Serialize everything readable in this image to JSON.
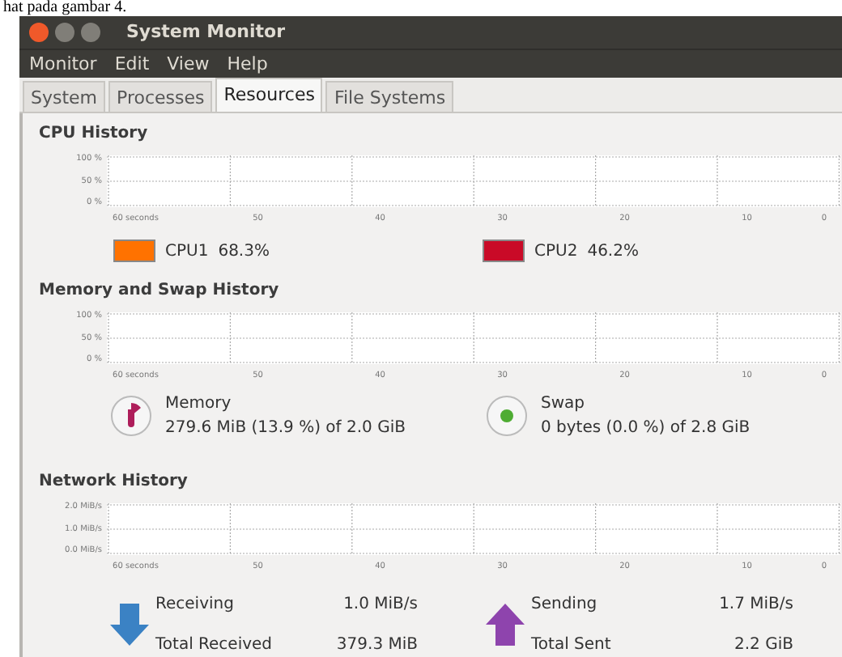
{
  "document_line": "hat pada gambar 4.",
  "window": {
    "title": "System Monitor"
  },
  "menu": [
    "Monitor",
    "Edit",
    "View",
    "Help"
  ],
  "tabs": [
    {
      "label": "System",
      "selected": false
    },
    {
      "label": "Processes",
      "selected": false
    },
    {
      "label": "Resources",
      "selected": true
    },
    {
      "label": "File Systems",
      "selected": false
    }
  ],
  "cpu": {
    "title": "CPU History",
    "graph": {
      "y_labels": [
        "100 %",
        "50 %",
        "0 %"
      ],
      "x_labels": [
        "60 seconds",
        "50",
        "40",
        "30",
        "20",
        "10",
        "0"
      ]
    },
    "legend": [
      {
        "label": "CPU1",
        "value": "68.3%",
        "color": "#ff7200"
      },
      {
        "label": "CPU2",
        "value": "46.2%",
        "color": "#c90a27"
      }
    ]
  },
  "memory": {
    "title": "Memory and Swap History",
    "graph": {
      "y_labels": [
        "100 %",
        "50 %",
        "0 %"
      ],
      "x_labels": [
        "60 seconds",
        "50",
        "40",
        "30",
        "20",
        "10",
        "0"
      ]
    },
    "items": [
      {
        "kind": "pie",
        "name": "Memory",
        "detail": "279.6 MiB (13.9 %) of 2.0 GiB",
        "color": "#ae1e5b"
      },
      {
        "kind": "dot",
        "name": "Swap",
        "detail": "0 bytes (0.0 %) of 2.8 GiB",
        "color": "#4eac33"
      }
    ]
  },
  "network": {
    "title": "Network History",
    "graph": {
      "y_labels": [
        "2.0 MiB/s",
        "1.0 MiB/s",
        "0.0 MiB/s"
      ],
      "x_labels": [
        "60 seconds",
        "50",
        "40",
        "30",
        "20",
        "10",
        "0"
      ]
    },
    "items": [
      {
        "kind": "down",
        "label": "Receiving",
        "rate": "1.0 MiB/s",
        "total_label": "Total Received",
        "total": "379.3 MiB"
      },
      {
        "kind": "up",
        "label": "Sending",
        "rate": "1.7 MiB/s",
        "total_label": "Total Sent",
        "total": "2.2 GiB"
      }
    ]
  }
}
